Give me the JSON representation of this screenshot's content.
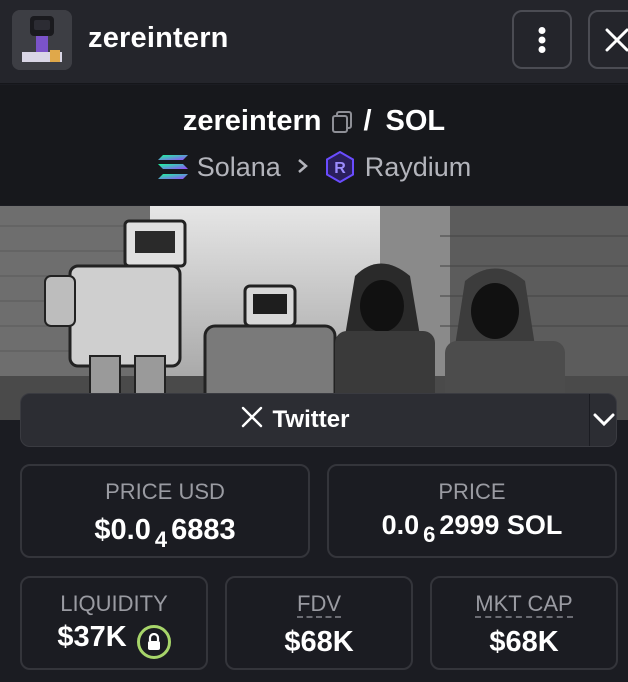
{
  "header": {
    "title": "zereintern",
    "avatar_icon": "token-avatar",
    "menu_icon": "vertical-dots-icon",
    "close_icon": "close-icon"
  },
  "pair": {
    "base": "zereintern",
    "separator": "/",
    "quote": "SOL",
    "chain": "Solana",
    "dex": "Raydium"
  },
  "links": {
    "twitter_label": "Twitter"
  },
  "stats": {
    "price_usd": {
      "label": "PRICE USD",
      "prefix": "$0.0",
      "zeros": "4",
      "digits": "6883"
    },
    "price": {
      "label": "PRICE",
      "prefix": "0.0",
      "zeros": "6",
      "digits": "2999 SOL"
    },
    "liquidity": {
      "label": "LIQUIDITY",
      "value": "$37K"
    },
    "fdv": {
      "label": "FDV",
      "value": "$68K"
    },
    "mkt_cap": {
      "label": "MKT CAP",
      "value": "$68K"
    }
  },
  "colors": {
    "background": "#1b1c22",
    "header": "#24252b",
    "lock_ring": "#a7d56a",
    "raydium": "#6a4cff"
  }
}
